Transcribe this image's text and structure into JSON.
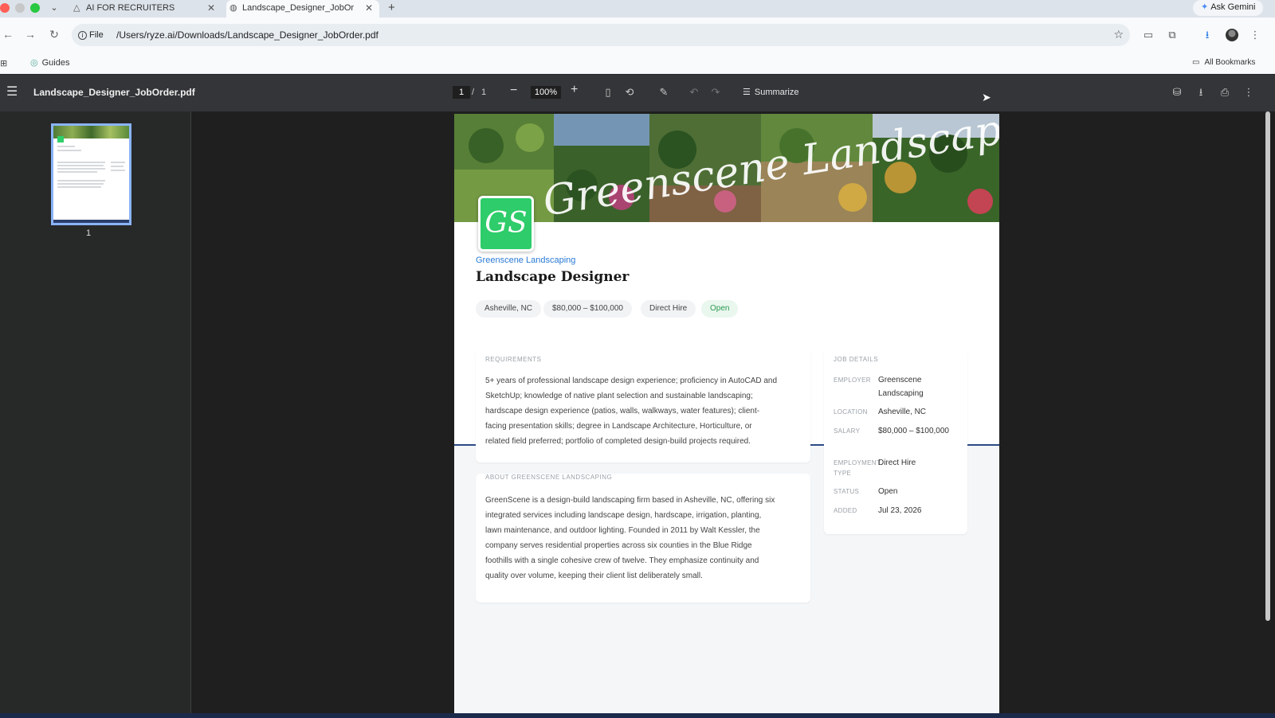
{
  "browser": {
    "tabs": [
      {
        "title": "AI FOR RECRUITERS",
        "icon": "warning-triangle-icon"
      },
      {
        "title": "Landscape_Designer_JobOrder.pdf",
        "icon": "globe-icon",
        "active": true
      }
    ],
    "ask_gemini": "Ask Gemini",
    "address": {
      "scheme_label": "File",
      "url": "/Users/ryze.ai/Downloads/Landscape_Designer_JobOrder.pdf"
    },
    "bookmarks": {
      "guides": "Guides",
      "all_bookmarks": "All Bookmarks"
    }
  },
  "pdf_viewer": {
    "filename": "Landscape_Designer_JobOrder.pdf",
    "current_page": "1",
    "page_separator": "/",
    "total_pages": "1",
    "zoom": "100%",
    "summarize_label": "Summarize",
    "thumbnail_number": "1"
  },
  "document": {
    "banner_script": "Greenscene Landscaping",
    "logo_text": "GS",
    "company": "Greenscene Landscaping",
    "job_title": "Landscape Designer",
    "chips": {
      "location": "Asheville, NC",
      "salary": "$80,000 – $100,000",
      "type": "Direct Hire",
      "status": "Open"
    },
    "requirements": {
      "label": "REQUIREMENTS",
      "lines": [
        "5+ years of professional landscape design experience; proficiency in AutoCAD and",
        "SketchUp; knowledge of native plant selection and sustainable landscaping;",
        "hardscape design experience (patios, walls, walkways, water features); client-",
        "facing presentation skills; degree in Landscape Architecture, Horticulture, or",
        "related field preferred; portfolio of completed design-build projects required."
      ]
    },
    "about": {
      "label": "ABOUT GREENSCENE LANDSCAPING",
      "lines": [
        "GreenScene is a design-build landscaping firm based in Asheville, NC, offering six",
        "integrated services including landscape design, hardscape, irrigation, planting,",
        "lawn maintenance, and outdoor lighting. Founded in 2011 by Walt Kessler, the",
        "company serves residential properties across six counties in the Blue Ridge",
        "foothills with a single cohesive crew of twelve. They emphasize continuity and",
        "quality over volume, keeping their client list deliberately small."
      ]
    },
    "job_details": {
      "label": "JOB DETAILS",
      "rows": [
        {
          "label": "EMPLOYER",
          "value": "Greenscene Landscaping"
        },
        {
          "label": "LOCATION",
          "value": "Asheville, NC"
        },
        {
          "label": "SALARY",
          "value": "$80,000 – $100,000"
        },
        {
          "label": "EMPLOYMENT TYPE",
          "value": "Direct Hire"
        },
        {
          "label": "STATUS",
          "value": "Open"
        },
        {
          "label": "ADDED",
          "value": "Jul 23, 2026"
        }
      ]
    }
  },
  "colors": {
    "accent_blue": "#2a7ad5",
    "logo_green": "#2ecc6a",
    "open_green": "#2d9a52",
    "header_rule": "#2c4a85"
  }
}
